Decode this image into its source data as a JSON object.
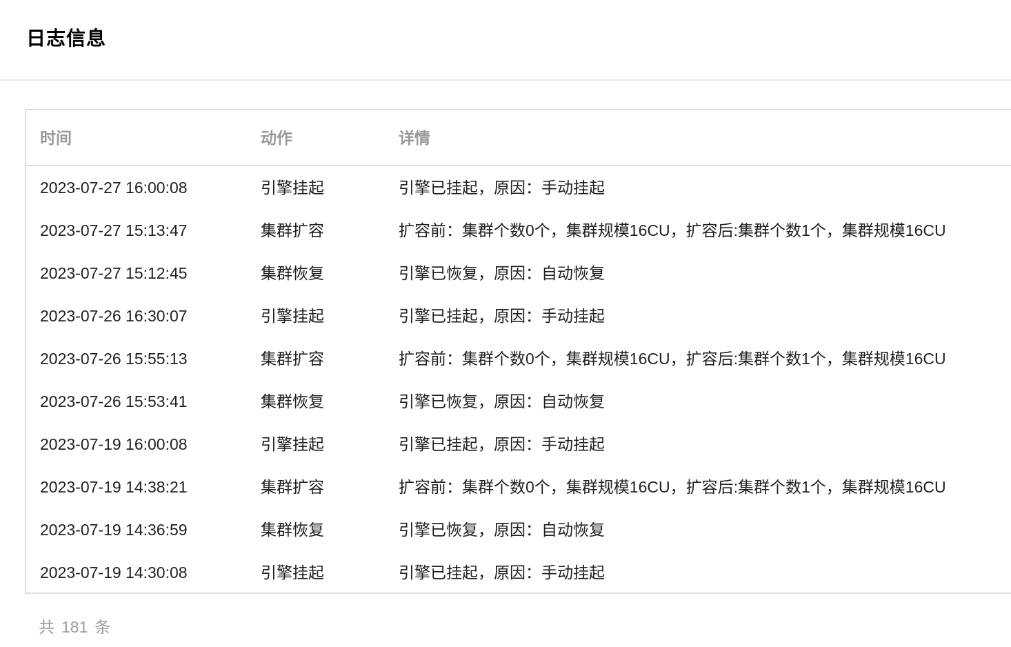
{
  "panel": {
    "title": "日志信息"
  },
  "table": {
    "headers": {
      "time": "时间",
      "action": "动作",
      "detail": "详情"
    },
    "rows": [
      {
        "time": "2023-07-27 16:00:08",
        "action": "引擎挂起",
        "detail": "引擎已挂起，原因：手动挂起"
      },
      {
        "time": "2023-07-27 15:13:47",
        "action": "集群扩容",
        "detail": "扩容前：集群个数0个，集群规模16CU，扩容后:集群个数1个，集群规模16CU"
      },
      {
        "time": "2023-07-27 15:12:45",
        "action": "集群恢复",
        "detail": "引擎已恢复，原因：自动恢复"
      },
      {
        "time": "2023-07-26 16:30:07",
        "action": "引擎挂起",
        "detail": "引擎已挂起，原因：手动挂起"
      },
      {
        "time": "2023-07-26 15:55:13",
        "action": "集群扩容",
        "detail": "扩容前：集群个数0个，集群规模16CU，扩容后:集群个数1个，集群规模16CU"
      },
      {
        "time": "2023-07-26 15:53:41",
        "action": "集群恢复",
        "detail": "引擎已恢复，原因：自动恢复"
      },
      {
        "time": "2023-07-19 16:00:08",
        "action": "引擎挂起",
        "detail": "引擎已挂起，原因：手动挂起"
      },
      {
        "time": "2023-07-19 14:38:21",
        "action": "集群扩容",
        "detail": "扩容前：集群个数0个，集群规模16CU，扩容后:集群个数1个，集群规模16CU"
      },
      {
        "time": "2023-07-19 14:36:59",
        "action": "集群恢复",
        "detail": "引擎已恢复，原因：自动恢复"
      },
      {
        "time": "2023-07-19 14:30:08",
        "action": "引擎挂起",
        "detail": "引擎已挂起，原因：手动挂起"
      }
    ]
  },
  "footer": {
    "total_prefix": "共",
    "total_count": "181",
    "total_suffix": "条"
  }
}
